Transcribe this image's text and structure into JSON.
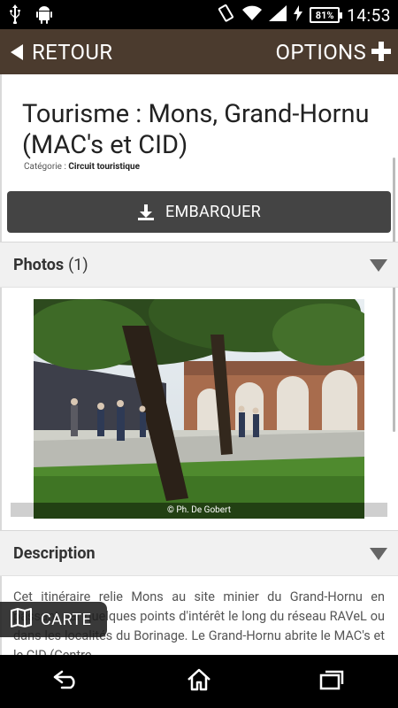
{
  "status_bar": {
    "time": "14:53",
    "battery": "81%"
  },
  "action_bar": {
    "back_label": "RETOUR",
    "options_label": "OPTIONS"
  },
  "page": {
    "title": "Tourisme : Mons, Grand-Hornu (MAC's et CID)",
    "category_prefix": "Catégorie :",
    "category_value": "Circuit touristique",
    "embark_label": "EMBARQUER"
  },
  "photos_section": {
    "label": "Photos",
    "count": "(1)",
    "credit": "© Ph. De Gobert"
  },
  "description_section": {
    "label": "Description",
    "text": "Cet itinéraire relie Mons au site minier du Grand-Hornu en passant par quelques points d'intérêt le long du réseau RAVeL ou dans les localités du Borinage. Le Grand-Hornu abrite le MAC's et le CID (Centre"
  },
  "map_button": {
    "label": "CARTE"
  },
  "icons": {
    "usb": "usb-icon",
    "android": "android-icon",
    "vibrate": "vibrate-icon",
    "wifi": "wifi-icon",
    "signal": "signal-icon",
    "charging": "charging-icon",
    "back": "back-arrow-icon",
    "plus": "plus-icon",
    "download": "download-icon",
    "map": "map-icon",
    "nav_back": "nav-back-icon",
    "nav_home": "nav-home-icon",
    "nav_recent": "nav-recent-apps-icon"
  },
  "colors": {
    "action_bar": "#4b3b2e",
    "button": "#444444",
    "section_bg": "#f1f1f1"
  }
}
